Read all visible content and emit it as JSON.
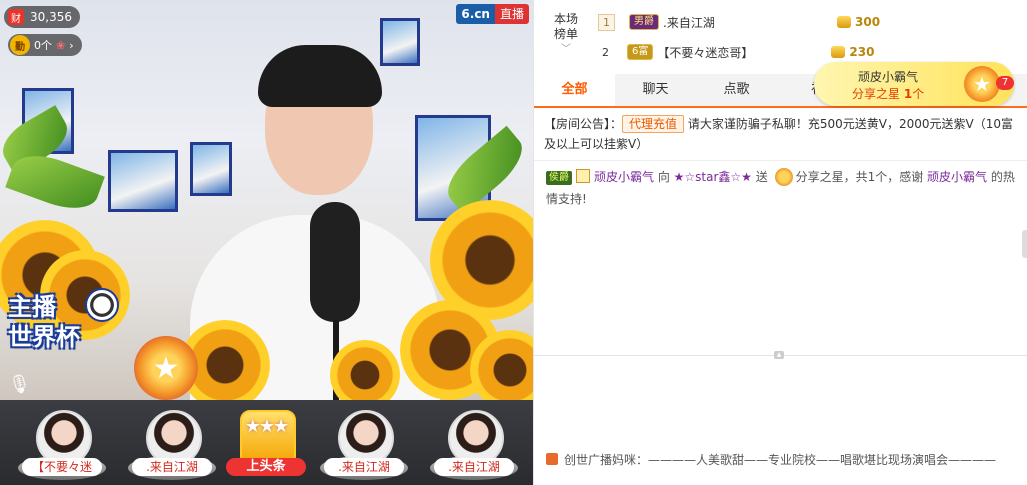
{
  "video": {
    "wealth_icon": "财",
    "wealth_value": "30,356",
    "qin_icon": "勤",
    "qin_text": "0个",
    "brand_site": "6.cn",
    "brand_live": "直播",
    "event_line1": "主播",
    "event_line2": "世界杯",
    "star_icon": "star-gift-icon",
    "mic_icon": "microphone-icon"
  },
  "fans": [
    {
      "name": "【不要々迷",
      "type": "avatar"
    },
    {
      "name": ".来自江湖",
      "type": "avatar"
    },
    {
      "name": "上头条",
      "type": "gold"
    },
    {
      "name": ".来自江湖",
      "type": "avatar"
    },
    {
      "name": ".来自江湖",
      "type": "avatar"
    }
  ],
  "ranking": {
    "label_line1": "本场",
    "label_line2": "榜单",
    "chevron": "﹀",
    "rows": [
      {
        "rank": "1",
        "level": "男爵",
        "name": ".来自江湖",
        "coins": "300"
      },
      {
        "rank": "2",
        "level": "6富",
        "name": "【不要々迷恋哥】",
        "coins": "230"
      }
    ]
  },
  "tabs": [
    {
      "label": "全部",
      "active": true
    },
    {
      "label": "聊天",
      "active": false
    },
    {
      "label": "点歌",
      "active": false
    },
    {
      "label": "礼",
      "active": false
    }
  ],
  "share_popup": {
    "user": "顽皮小霸气",
    "text_prefix": "分享之星",
    "count": "1",
    "unit": "个",
    "badge": "7"
  },
  "notice": {
    "prefix": "【房间公告】：",
    "tag": "代理充值",
    "text": " 请大家谨防骗子私聊！充500元送黄V，2000元送紫V（10富及以上可以挂紫V）"
  },
  "message": {
    "level": "侯爵",
    "user": "顽皮小霸气",
    "verb": " 向 ",
    "target": "★☆star鑫☆★",
    "action": " 送 ",
    "gift": "分享之星，共1个，感谢 ",
    "thanks_user": "顽皮小霸气",
    "tail": " 的热情支持!"
  },
  "bottom_text": "创世广播妈咪：————人美歌甜——专业院校——唱歌堪比现场演唱会————",
  "colors": {
    "accent": "#ff5a00",
    "brand_blue": "#1a5ea8",
    "live_red": "#dd3333"
  }
}
